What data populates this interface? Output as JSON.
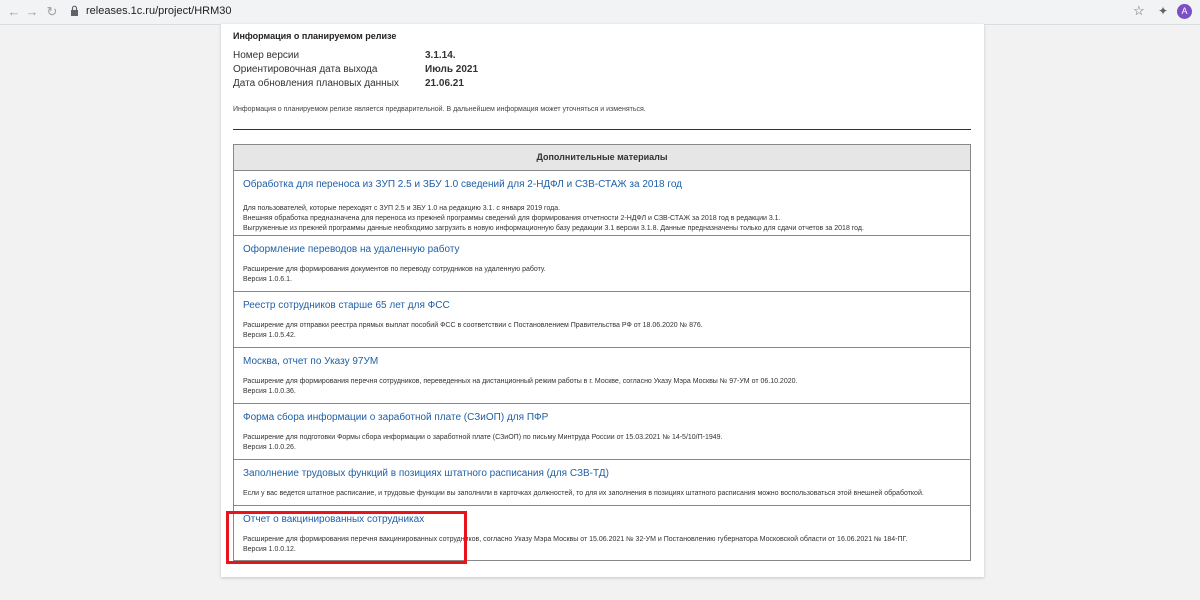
{
  "browser": {
    "url": "releases.1c.ru/project/HRM30",
    "avatar_letter": "A"
  },
  "info": {
    "title": "Информация о планируемом релизе",
    "rows": [
      {
        "label": "Номер версии",
        "value": "3.1.14."
      },
      {
        "label": "Ориентировочная дата выхода",
        "value": "Июль 2021"
      },
      {
        "label": "Дата обновления плановых данных",
        "value": "21.06.21"
      }
    ],
    "note": "Информация о планируемом релизе является предварительной. В дальнейшем информация может уточняться и изменяться."
  },
  "materials": {
    "header": "Дополнительные материалы",
    "items": [
      {
        "title": "Обработка для переноса из ЗУП 2.5 и ЗБУ 1.0 сведений для 2-НДФЛ и СЗВ-СТАЖ за 2018 год",
        "lines": [
          "Для пользователей, которые переходят с ЗУП 2.5 и ЗБУ 1.0 на редакцию 3.1. с января 2019 года.",
          "Внешняя обработка предназначена для переноса из прежней программы сведений для формирования отчетности 2-НДФЛ и СЗВ-СТАЖ за 2018 год в редакции 3.1.",
          "Выгруженные из прежней программы данные необходимо загрузить в новую информационную базу редакции 3.1 версии 3.1.8. Данные предназначены только для сдачи отчетов за 2018 год."
        ]
      },
      {
        "title": "Оформление переводов на удаленную работу",
        "lines": [
          "Расширение для формирования документов по переводу сотрудников на удаленную работу.",
          "Версия 1.0.6.1."
        ]
      },
      {
        "title": "Реестр сотрудников старше 65 лет для ФСС",
        "lines": [
          "Расширение для отправки реестра прямых выплат пособий ФСС в соответствии с Постановлением Правительства РФ от 18.06.2020 № 876.",
          "Версия 1.0.5.42."
        ]
      },
      {
        "title": "Москва, отчет по Указу 97УМ",
        "lines": [
          "Расширение для формирования перечня сотрудников, переведенных на дистанционный режим работы в г. Москве, согласно Указу Мэра Москвы № 97-УМ от 06.10.2020.",
          "Версия 1.0.0.36."
        ]
      },
      {
        "title": "Форма сбора информации о заработной плате (СЗиОП) для ПФР",
        "lines": [
          "Расширение для подготовки Формы сбора информации о заработной плате (СЗиОП) по письму Минтруда России от 15.03.2021 № 14-5/10/П-1949.",
          "Версия 1.0.0.26."
        ]
      },
      {
        "title": "Заполнение трудовых функций в позициях штатного расписания (для СЗВ-ТД)",
        "lines": [
          "Если у вас ведется штатное расписание, и трудовые функции вы заполнили в карточках должностей, то для их заполнения в позициях штатного расписания можно воспользоваться этой внешней обработкой."
        ]
      },
      {
        "title": "Отчет о вакцинированных сотрудниках",
        "lines": [
          "Расширение для формирования перечня вакцинированных сотрудников, согласно Указу Мэра Москвы от 15.06.2021 № 32-УМ и Постановлению губернатора Московской области от 16.06.2021 № 184-ПГ.",
          "Версия 1.0.0.12."
        ]
      }
    ]
  },
  "colors": {
    "link": "#1f5fa6",
    "highlight": "#e8141b"
  }
}
